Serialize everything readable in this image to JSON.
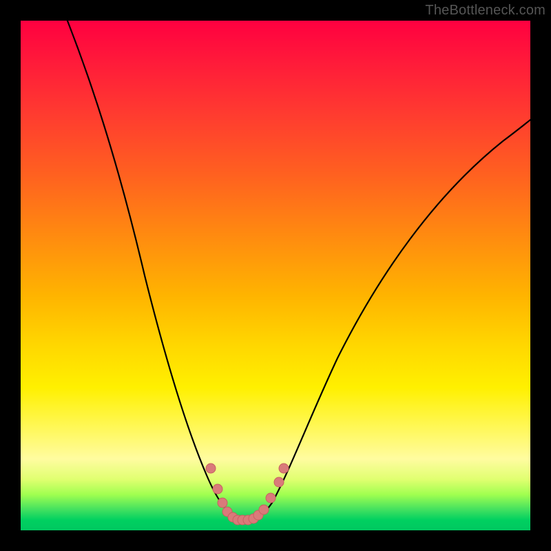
{
  "watermark": "TheBottleneck.com",
  "colors": {
    "background": "#000000",
    "curve_stroke": "#000000",
    "marker_fill": "#d97a7a",
    "marker_stroke": "#c86060",
    "gradient_top": "#ff0040",
    "gradient_bottom": "#00c860"
  },
  "chart_data": {
    "type": "line",
    "title": "",
    "xlabel": "",
    "ylabel": "",
    "x": [
      0.0,
      0.05,
      0.1,
      0.15,
      0.2,
      0.25,
      0.3,
      0.35,
      0.38,
      0.4,
      0.42,
      0.44,
      0.46,
      0.48,
      0.5,
      0.55,
      0.6,
      0.65,
      0.7,
      0.75,
      0.8,
      0.85,
      0.9,
      0.95,
      1.0
    ],
    "values": [
      100,
      100,
      97,
      88,
      74,
      58,
      40,
      22,
      10,
      4,
      1,
      0,
      0,
      1,
      5,
      14,
      24,
      33,
      41,
      49,
      56,
      62,
      67,
      72,
      76
    ],
    "xlim": [
      0,
      1
    ],
    "ylim": [
      0,
      100
    ],
    "annotations": {
      "markers": [
        {
          "x": 0.37,
          "y": 12
        },
        {
          "x": 0.385,
          "y": 7
        },
        {
          "x": 0.395,
          "y": 4
        },
        {
          "x": 0.405,
          "y": 2
        },
        {
          "x": 0.415,
          "y": 1
        },
        {
          "x": 0.425,
          "y": 0
        },
        {
          "x": 0.435,
          "y": 0
        },
        {
          "x": 0.445,
          "y": 0
        },
        {
          "x": 0.455,
          "y": 0
        },
        {
          "x": 0.465,
          "y": 1
        },
        {
          "x": 0.48,
          "y": 2
        },
        {
          "x": 0.495,
          "y": 5
        },
        {
          "x": 0.51,
          "y": 9
        },
        {
          "x": 0.52,
          "y": 12
        }
      ]
    }
  }
}
